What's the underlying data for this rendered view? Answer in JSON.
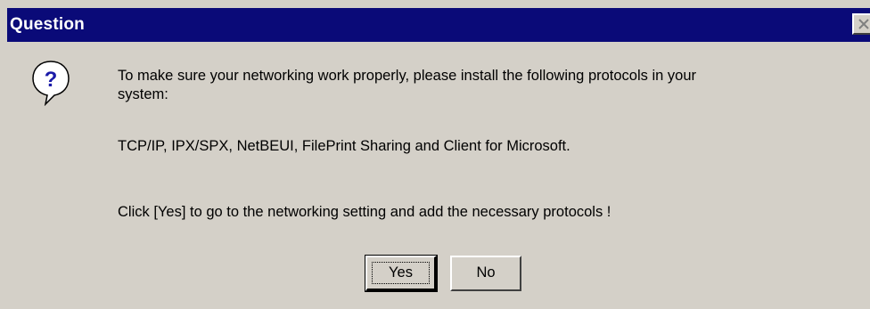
{
  "dialog": {
    "title": "Question",
    "icon": "question-icon",
    "message_line1": "To make sure your networking work properly, please install the following protocols in your",
    "message_line1b": "system:",
    "message_line2": "TCP/IP, IPX/SPX, NetBEUI, FilePrint Sharing and Client for Microsoft.",
    "message_line3": "Click [Yes] to go to the networking setting and add the necessary protocols !"
  },
  "buttons": {
    "yes_label": "Yes",
    "no_label": "No"
  },
  "colors": {
    "titlebar": "#0a0a78",
    "dialog_bg": "#d4d0c8",
    "title_text": "#ffffff"
  }
}
